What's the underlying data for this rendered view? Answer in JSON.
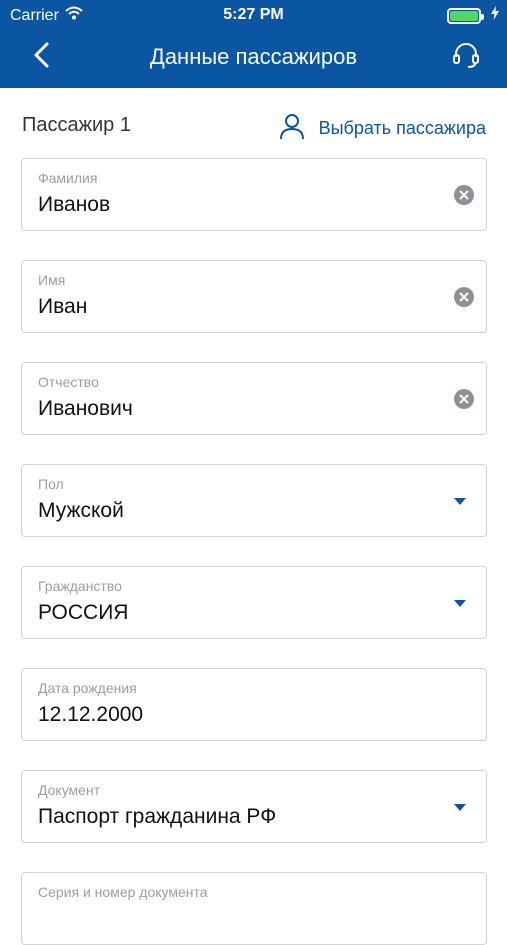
{
  "status": {
    "carrier": "Carrier",
    "time": "5:27 PM",
    "battery_level": 1.0,
    "icons": [
      "wifi-icon",
      "battery-icon",
      "charging-icon"
    ]
  },
  "nav": {
    "title": "Данные пассажиров",
    "back_icon": "chevron-left-icon",
    "support_icon": "headset-icon"
  },
  "passenger": {
    "title": "Пассажир 1",
    "choose_label": "Выбрать пассажира",
    "choose_icon": "user-icon"
  },
  "fields": [
    {
      "label": "Фамилия",
      "value": "Иванов",
      "control": "clear"
    },
    {
      "label": "Имя",
      "value": "Иван",
      "control": "clear"
    },
    {
      "label": "Отчество",
      "value": "Иванович",
      "control": "clear"
    },
    {
      "label": "Пол",
      "value": "Мужской",
      "control": "dropdown"
    },
    {
      "label": "Гражданство",
      "value": "РОССИЯ",
      "control": "dropdown"
    },
    {
      "label": "Дата рождения",
      "value": "12.12.2000",
      "control": "none"
    },
    {
      "label": "Документ",
      "value": "Паспорт гражданина РФ",
      "control": "dropdown"
    },
    {
      "label": "Серия и номер документа",
      "value": "",
      "control": "none"
    }
  ],
  "colors": {
    "brand": "#0a56a3",
    "battery": "#4cd964",
    "border": "#cfd3d8"
  }
}
